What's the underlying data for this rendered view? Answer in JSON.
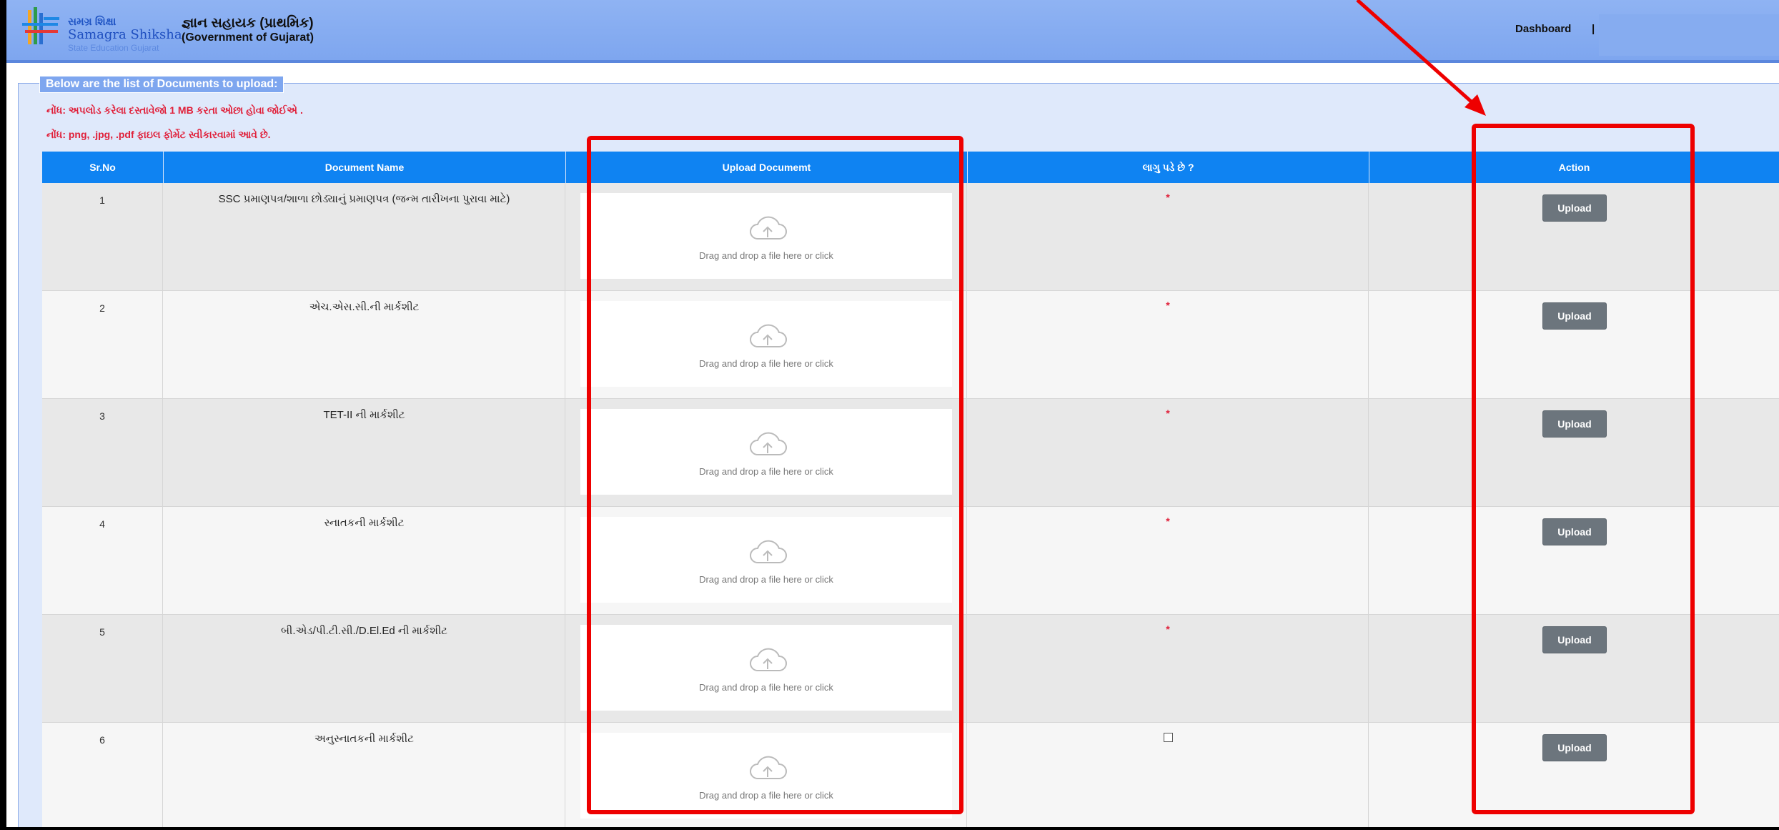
{
  "header": {
    "brand_top": "સમગ્ર શિક્ષા",
    "brand_name": "Samagra Shiksha",
    "brand_sub": "State Education Gujarat",
    "title_main": "જ્ઞાન સહાયક (પ્રાથમિક)",
    "title_sub": "(Government of Gujarat)",
    "nav_dashboard": "Dashboard",
    "nav_divider": "|"
  },
  "panel": {
    "legend": "Below are the list of Documents to upload:",
    "note1": "નોંધ: અપલોડ કરેલા દસ્તાવેજો 1 MB કરતા ઓછા હોવા જોઈએ .",
    "note2": "નોંધ: png, .jpg, .pdf ફાઇલ ફોર્મેટ સ્વીકારવામાં આવે છે."
  },
  "table": {
    "headers": {
      "sr": "Sr.No",
      "name": "Document Name",
      "upload": "Upload Documemt",
      "applicable": "લાગુ પડે છે ?",
      "action": "Action"
    },
    "drop_text": "Drag and drop a file here or click",
    "upload_label": "Upload",
    "required_mark": "*",
    "rows": [
      {
        "sr": "1",
        "name": "SSC પ્રમાણપત્ર/શાળા છોડ્યાનું પ્રમાણપત્ર (જન્મ તારીખના પુરાવા માટે)"
      },
      {
        "sr": "2",
        "name": "એચ.એસ.સી.ની માર્કશીટ"
      },
      {
        "sr": "3",
        "name": "TET-II ની માર્કશીટ"
      },
      {
        "sr": "4",
        "name": "સ્નાતકની માર્કશીટ"
      },
      {
        "sr": "5",
        "name": "બી.એડ/પી.ટી.સી./D.El.Ed ની માર્કશીટ"
      },
      {
        "sr": "6",
        "name": "અનુસ્નાતકની માર્કશીટ"
      }
    ]
  },
  "colors": {
    "header_bg": "#8fb3f3",
    "table_header": "#0f83f2",
    "note_red": "#e0203a",
    "button_gray": "#6c757d",
    "annotation_red": "#ee0000"
  }
}
